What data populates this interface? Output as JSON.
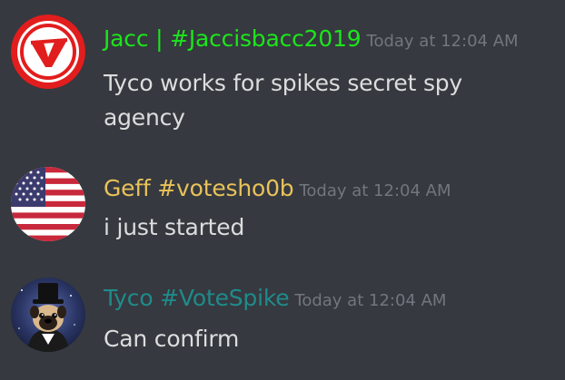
{
  "colors": {
    "background": "#36393f",
    "timestamp": "#72767d",
    "message_text": "#dcddde"
  },
  "messages": [
    {
      "author": "Jacc | #Jaccisbacc2019",
      "author_color": "#1ce51c",
      "timestamp": "Today at 12:04 AM",
      "text": "Tyco works for spikes secret spy agency",
      "avatar": "red-v-logo-icon"
    },
    {
      "author": "Geff #votesho0b",
      "author_color": "#e8c25a",
      "timestamp": "Today at 12:04 AM",
      "text": "i just started",
      "avatar": "us-flag-icon"
    },
    {
      "author": "Tyco #VoteSpike",
      "author_color": "#1f8b8b",
      "timestamp": "Today at 12:04 AM",
      "text": "Can confirm",
      "avatar": "pug-top-hat-icon"
    }
  ]
}
